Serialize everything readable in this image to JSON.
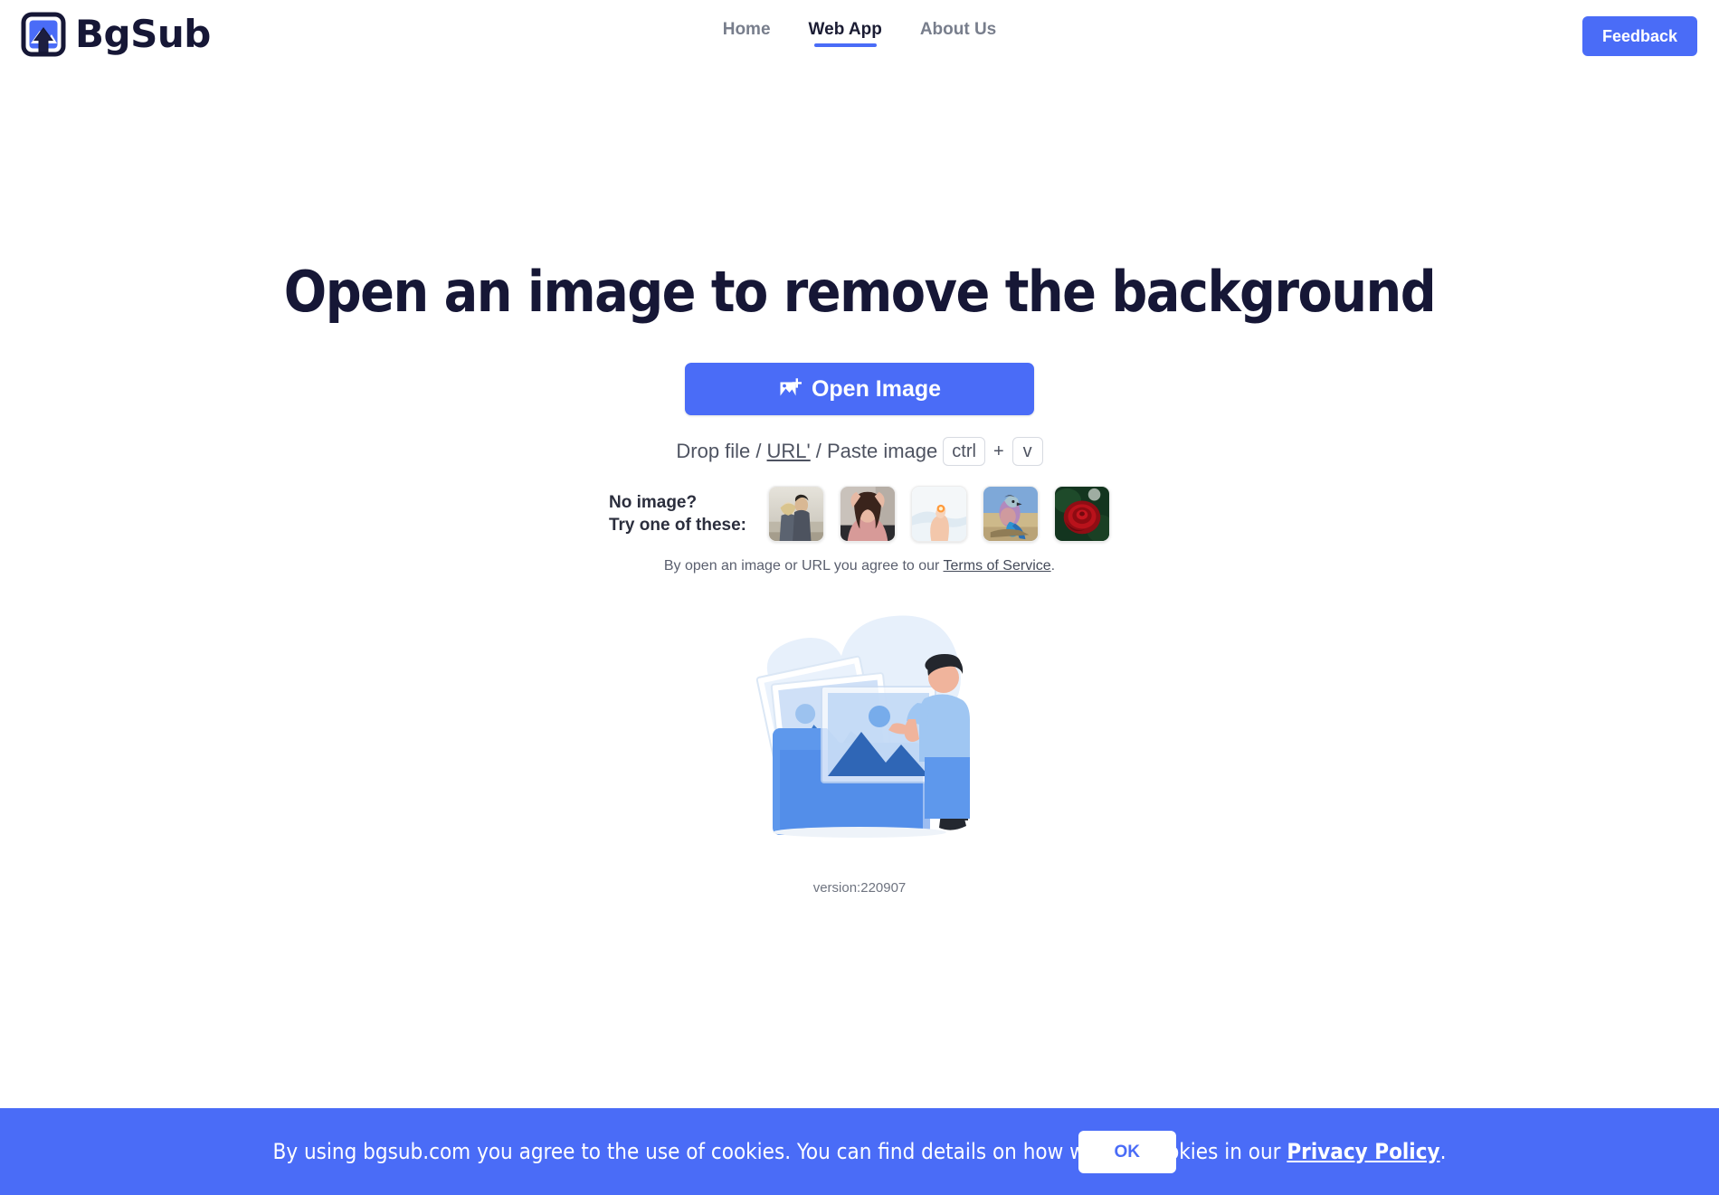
{
  "brand": {
    "name": "BgSub",
    "logo_icon": "image-upload-logo-icon"
  },
  "nav": {
    "items": [
      {
        "label": "Home",
        "active": false
      },
      {
        "label": "Web App",
        "active": true
      },
      {
        "label": "About Us",
        "active": false
      }
    ],
    "feedback_label": "Feedback"
  },
  "main": {
    "headline": "Open an image to remove the background",
    "open_button": {
      "label": "Open Image",
      "icon": "add-image-icon"
    },
    "drop_hint": {
      "prefix": "Drop file /",
      "url_label": "URL'",
      "middle": "/ Paste image",
      "key_ctrl": "ctrl",
      "key_plus": "+",
      "key_v": "v"
    },
    "samples": {
      "label_line1": "No image?",
      "label_line2": "Try one of these:",
      "thumbnails": [
        {
          "name": "couple-on-beach-thumbnail"
        },
        {
          "name": "woman-portrait-thumbnail"
        },
        {
          "name": "hand-holding-light-thumbnail"
        },
        {
          "name": "lilac-breasted-roller-bird-thumbnail"
        },
        {
          "name": "red-rose-thumbnail"
        }
      ]
    },
    "terms": {
      "text_before": "By open an image or URL you agree to our ",
      "link_label": "Terms of Service",
      "text_after": "."
    },
    "illustration_name": "person-with-photos-folder-illustration",
    "version": "version:220907"
  },
  "cookie_banner": {
    "text_before": "By using bgsub.com you agree to the use of cookies. You can find details on how we use cookies in our ",
    "link_label": "Privacy Policy",
    "text_after": ".",
    "ok_label": "OK"
  },
  "colors": {
    "brand_blue": "#4a6cf7",
    "heading_navy": "#161736",
    "muted_text": "#787e8c"
  }
}
